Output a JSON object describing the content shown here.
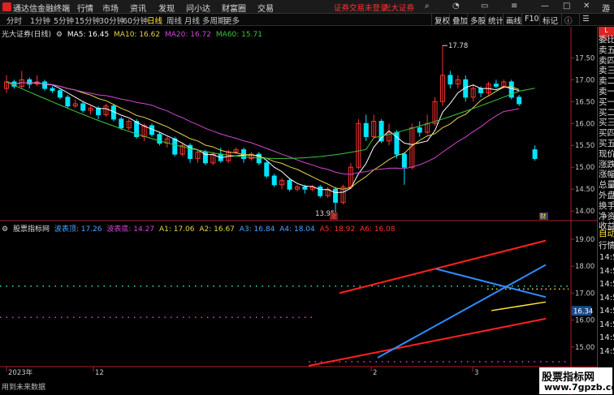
{
  "app": {
    "title": "通达信金融终端"
  },
  "menu": [
    {
      "label": "行情"
    },
    {
      "label": "市场"
    },
    {
      "label": "资讯"
    },
    {
      "label": "发现"
    },
    {
      "label": "问小达"
    },
    {
      "label": "财富圈"
    },
    {
      "label": "交易"
    }
  ],
  "notices": {
    "trade_login": "证券交易未登录",
    "broker": "光大证券"
  },
  "guest_label": "游客",
  "periods": [
    {
      "label": "分时"
    },
    {
      "label": "1分钟"
    },
    {
      "label": "5分钟"
    },
    {
      "label": "15分钟"
    },
    {
      "label": "30分钟"
    },
    {
      "label": "60分钟"
    },
    {
      "label": "日线"
    },
    {
      "label": "周线"
    },
    {
      "label": "月线"
    },
    {
      "label": "多周期"
    },
    {
      "label": "更多"
    }
  ],
  "right_tools": [
    {
      "label": "复权"
    },
    {
      "label": "叠加"
    },
    {
      "label": "多股"
    },
    {
      "label": "统计"
    },
    {
      "label": "画线"
    },
    {
      "label": "F10"
    },
    {
      "label": "标记"
    }
  ],
  "main_legend": {
    "name": "光大证券(日线)",
    "ma5": "MA5: 16.45",
    "ma10": "MA10: 16.62",
    "ma20": "MA20: 16.72",
    "ma60": "MA60: 15.71"
  },
  "indicator_legend": {
    "name": "股票指标网",
    "a": "波表顶: 17.26",
    "b": "波表底: 14.27",
    "c": "A1: 17.06",
    "d": "A2: 16.67",
    "e": "A3: 16.84",
    "f": "A4: 18.04",
    "g": "A5: 18.92",
    "h": "A6: 16.08"
  },
  "price_axis": [
    "17.50",
    "17.00",
    "16.50",
    "16.00",
    "15.50",
    "15.00",
    "14.50",
    "14.00"
  ],
  "ind_axis": [
    "19.00",
    "18.00",
    "17.00",
    "16.00",
    "15.00"
  ],
  "ind_last_price": "16.34",
  "annotations": {
    "high": "17.78",
    "low": "13.95",
    "rise_tag": "涨",
    "fin_tag": "财"
  },
  "date_axis": [
    "2023年",
    "12",
    "2",
    "3"
  ],
  "bottom_note": "用到未来数据",
  "right_panel": {
    "top_tag": "L",
    "top_tag_sub": "300",
    "items": [
      "委比",
      "卖五",
      "卖四",
      "卖三",
      "卖二",
      "卖一",
      "买一",
      "买二",
      "买三",
      "买四",
      "买五",
      "现价",
      "涨跌",
      "涨幅",
      "总量",
      "外盘",
      "换手",
      "净资",
      "收益"
    ],
    "auto_label": "自动",
    "quote_label": "行情",
    "times": [
      "14:50",
      "14:50",
      "14:50",
      "14:50",
      "14:50",
      "14:50",
      "14:50",
      "14:50"
    ]
  },
  "watermark": {
    "line1": "股票指标网",
    "line2": "www.7gpzb.com"
  },
  "colors": {
    "up": "#ff3232",
    "down": "#00e5ff",
    "ma5": "#ffffff",
    "ma10": "#e6d24a",
    "ma20": "#d247d2",
    "ma60": "#3cc83c"
  },
  "chart_data": {
    "type": "candlestick",
    "ylim": [
      13.8,
      17.95
    ],
    "candles": [
      [
        16.8,
        16.95,
        16.7,
        17.1
      ],
      [
        16.95,
        16.85,
        16.8,
        17.0
      ],
      [
        16.85,
        17.0,
        16.8,
        17.2
      ],
      [
        17.0,
        16.9,
        16.8,
        17.05
      ],
      [
        16.9,
        16.95,
        16.85,
        17.1
      ],
      [
        16.95,
        16.8,
        16.75,
        17.0
      ],
      [
        16.8,
        16.75,
        16.7,
        16.85
      ],
      [
        16.75,
        16.6,
        16.55,
        16.8
      ],
      [
        16.6,
        16.4,
        16.35,
        16.65
      ],
      [
        16.4,
        16.45,
        16.35,
        16.55
      ],
      [
        16.45,
        16.3,
        16.25,
        16.5
      ],
      [
        16.3,
        16.35,
        16.2,
        16.4
      ],
      [
        16.35,
        16.2,
        16.1,
        16.4
      ],
      [
        16.2,
        16.4,
        16.15,
        16.45
      ],
      [
        16.4,
        16.1,
        16.05,
        16.45
      ],
      [
        16.1,
        15.9,
        15.85,
        16.15
      ],
      [
        15.9,
        16.05,
        15.85,
        16.1
      ],
      [
        16.05,
        15.7,
        15.65,
        16.1
      ],
      [
        15.7,
        15.95,
        15.6,
        16.0
      ],
      [
        15.95,
        15.75,
        15.7,
        16.0
      ],
      [
        15.75,
        15.55,
        15.5,
        15.8
      ],
      [
        15.55,
        15.65,
        15.45,
        15.7
      ],
      [
        15.65,
        15.3,
        15.25,
        15.7
      ],
      [
        15.3,
        15.5,
        15.25,
        15.55
      ],
      [
        15.5,
        15.2,
        15.1,
        15.55
      ],
      [
        15.2,
        15.35,
        15.1,
        15.4
      ],
      [
        15.35,
        15.1,
        15.05,
        15.4
      ],
      [
        15.1,
        15.3,
        15.05,
        15.35
      ],
      [
        15.3,
        15.15,
        15.1,
        15.45
      ],
      [
        15.15,
        15.35,
        15.1,
        15.4
      ],
      [
        15.35,
        15.4,
        15.3,
        15.45
      ],
      [
        15.4,
        15.2,
        15.1,
        15.45
      ],
      [
        15.2,
        15.3,
        15.15,
        15.35
      ],
      [
        15.3,
        15.1,
        15.05,
        15.35
      ],
      [
        15.1,
        14.8,
        14.75,
        15.15
      ],
      [
        14.8,
        14.6,
        14.55,
        14.85
      ],
      [
        14.6,
        14.7,
        14.5,
        14.75
      ],
      [
        14.7,
        14.5,
        14.45,
        14.75
      ],
      [
        14.5,
        14.55,
        14.45,
        14.6
      ],
      [
        14.55,
        14.5,
        14.4,
        14.6
      ],
      [
        14.5,
        14.55,
        14.45,
        14.6
      ],
      [
        14.55,
        14.35,
        14.3,
        14.6
      ],
      [
        14.35,
        14.5,
        14.3,
        14.55
      ],
      [
        14.5,
        14.2,
        13.95,
        14.55
      ],
      [
        14.2,
        14.55,
        14.15,
        14.6
      ],
      [
        14.55,
        15.0,
        14.5,
        15.1
      ],
      [
        15.0,
        16.0,
        14.95,
        16.1
      ],
      [
        16.0,
        15.7,
        15.6,
        16.2
      ],
      [
        15.7,
        16.05,
        15.65,
        16.2
      ],
      [
        16.05,
        15.6,
        15.55,
        16.1
      ],
      [
        15.6,
        15.8,
        15.5,
        16.0
      ],
      [
        15.8,
        15.3,
        15.2,
        15.85
      ],
      [
        15.3,
        15.0,
        14.6,
        15.35
      ],
      [
        15.0,
        15.9,
        14.95,
        16.0
      ],
      [
        15.9,
        15.8,
        15.7,
        16.05
      ],
      [
        15.8,
        16.0,
        15.75,
        16.2
      ],
      [
        16.0,
        16.5,
        15.95,
        16.6
      ],
      [
        16.5,
        17.1,
        16.4,
        17.78
      ],
      [
        17.1,
        16.9,
        16.8,
        17.2
      ],
      [
        16.9,
        17.0,
        16.8,
        17.1
      ],
      [
        17.0,
        16.6,
        16.5,
        17.1
      ],
      [
        16.6,
        16.8,
        16.5,
        16.9
      ],
      [
        16.8,
        16.7,
        16.6,
        16.85
      ],
      [
        16.7,
        16.9,
        16.65,
        16.95
      ],
      [
        16.9,
        16.85,
        16.8,
        17.0
      ],
      [
        16.85,
        16.95,
        16.8,
        17.0
      ],
      [
        16.95,
        16.6,
        16.55,
        17.0
      ],
      [
        16.6,
        16.45,
        16.4,
        16.65
      ],
      [
        15.4,
        15.2,
        15.15,
        15.5
      ]
    ]
  }
}
